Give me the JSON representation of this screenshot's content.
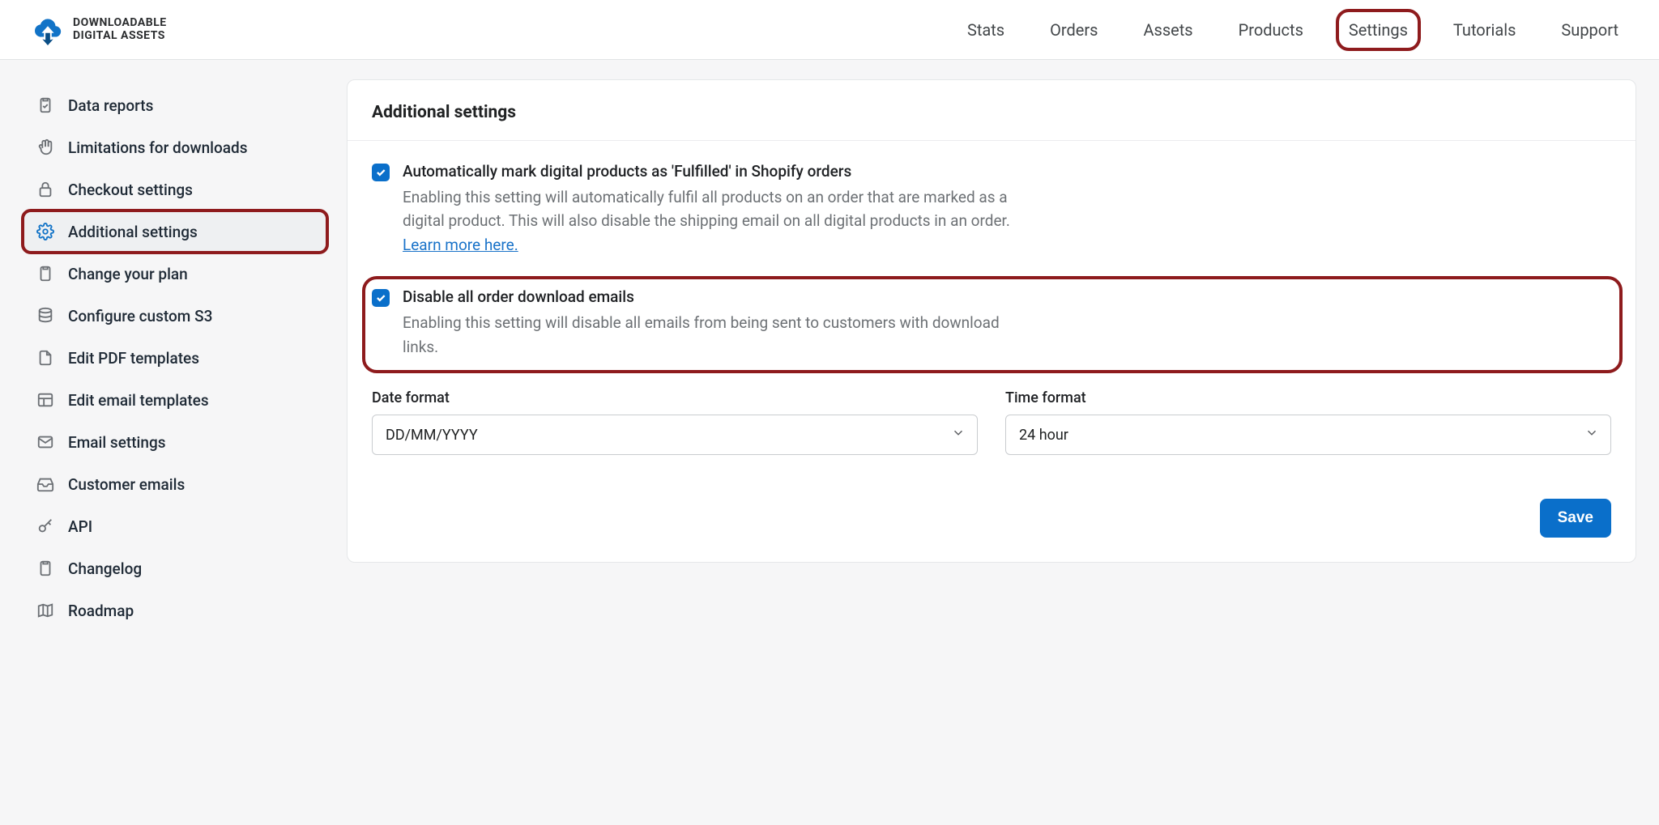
{
  "brand": {
    "line1": "DOWNLOADABLE",
    "line2": "DIGITAL ASSETS"
  },
  "nav": {
    "items": [
      {
        "label": "Stats"
      },
      {
        "label": "Orders"
      },
      {
        "label": "Assets"
      },
      {
        "label": "Products"
      },
      {
        "label": "Settings",
        "highlighted": true
      },
      {
        "label": "Tutorials"
      },
      {
        "label": "Support"
      }
    ]
  },
  "sidebar": {
    "items": [
      {
        "icon": "clipboard-check",
        "label": "Data reports"
      },
      {
        "icon": "hand",
        "label": "Limitations for downloads"
      },
      {
        "icon": "lock",
        "label": "Checkout settings"
      },
      {
        "icon": "gear",
        "label": "Additional settings",
        "active": true,
        "highlighted": true
      },
      {
        "icon": "clipboard",
        "label": "Change your plan"
      },
      {
        "icon": "database",
        "label": "Configure custom S3"
      },
      {
        "icon": "file",
        "label": "Edit PDF templates"
      },
      {
        "icon": "layout",
        "label": "Edit email templates"
      },
      {
        "icon": "envelope",
        "label": "Email settings"
      },
      {
        "icon": "inbox",
        "label": "Customer emails"
      },
      {
        "icon": "key",
        "label": "API"
      },
      {
        "icon": "clipboard",
        "label": "Changelog"
      },
      {
        "icon": "map",
        "label": "Roadmap"
      }
    ]
  },
  "panel": {
    "title": "Additional settings",
    "settings": {
      "auto_fulfil": {
        "checked": true,
        "title": "Automatically mark digital products as 'Fulfilled' in Shopify orders",
        "desc": "Enabling this setting will automatically fulfil all products on an order that are marked as a digital product. This will also disable the shipping email on all digital products in an order. ",
        "link_label": "Learn more here."
      },
      "disable_emails": {
        "checked": true,
        "highlighted": true,
        "title": "Disable all order download emails",
        "desc": "Enabling this setting will disable all emails from being sent to customers with download links."
      }
    },
    "date_format": {
      "label": "Date format",
      "value": "DD/MM/YYYY"
    },
    "time_format": {
      "label": "Time format",
      "value": "24 hour"
    },
    "save_label": "Save"
  }
}
